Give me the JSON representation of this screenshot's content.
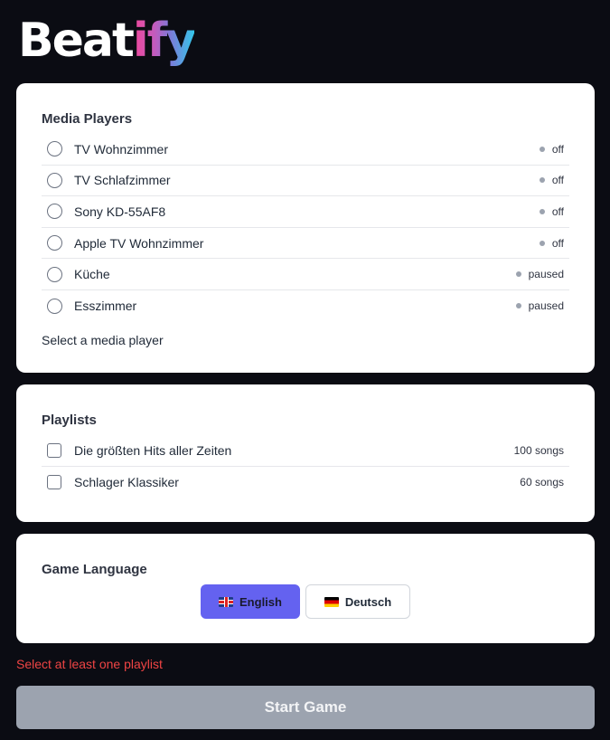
{
  "logo": {
    "text_main": "Beat",
    "text_accent": "ify"
  },
  "media_players": {
    "title": "Media Players",
    "items": [
      {
        "label": "TV Wohnzimmer",
        "status": "off"
      },
      {
        "label": "TV Schlafzimmer",
        "status": "off"
      },
      {
        "label": "Sony KD-55AF8",
        "status": "off"
      },
      {
        "label": "Apple TV Wohnzimmer",
        "status": "off"
      },
      {
        "label": "Küche",
        "status": "paused"
      },
      {
        "label": "Esszimmer",
        "status": "paused"
      }
    ],
    "helper": "Select a media player"
  },
  "playlists": {
    "title": "Playlists",
    "items": [
      {
        "label": "Die größten Hits aller Zeiten",
        "count": "100 songs"
      },
      {
        "label": "Schlager Klassiker",
        "count": "60 songs"
      }
    ]
  },
  "language": {
    "title": "Game Language",
    "options": [
      {
        "label": "English",
        "flag_icon": "uk-flag-icon",
        "selected": true
      },
      {
        "label": "Deutsch",
        "flag_icon": "de-flag-icon",
        "selected": false
      }
    ]
  },
  "error_text": "Select at least one playlist",
  "start_button": "Start Game",
  "colors": {
    "background": "#0b0c13",
    "accent": "#6462f0",
    "error": "#ef4444",
    "disabled_button": "#9ca3af"
  }
}
